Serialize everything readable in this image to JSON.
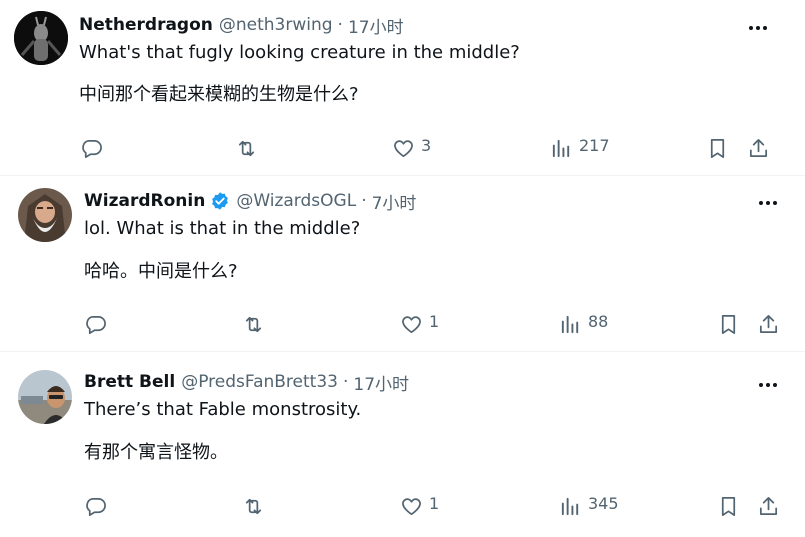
{
  "replies": [
    {
      "display_name": "Netherdragon",
      "handle": "@neth3rwing",
      "separator": "·",
      "time": "17小时",
      "text_en": "What's that fugly looking creature in the middle?",
      "text_zh": "中间那个看起来模糊的生物是什么?",
      "likes": "3",
      "views": "217",
      "verified": false
    },
    {
      "display_name": "WizardRonin",
      "handle": "@WizardsOGL",
      "separator": "·",
      "time": "7小时",
      "text_en": "lol.  What is that in the middle?",
      "text_zh": "哈哈。中间是什么?",
      "likes": "1",
      "views": "88",
      "verified": true
    },
    {
      "display_name": "Brett Bell",
      "handle": "@PredsFanBrett33",
      "separator": "·",
      "time": "17小时",
      "text_en": "There’s that Fable monstrosity.",
      "text_zh": "有那个寓言怪物。",
      "likes": "1",
      "views": "345",
      "verified": false
    }
  ],
  "colors": {
    "text": "#0f1419",
    "secondary": "#536471",
    "verified": "#1d9bf0",
    "divider": "#eff3f4"
  },
  "icons": [
    "reply-icon",
    "repost-icon",
    "like-icon",
    "views-icon",
    "bookmark-icon",
    "share-icon",
    "more-icon",
    "verified-badge-icon"
  ]
}
